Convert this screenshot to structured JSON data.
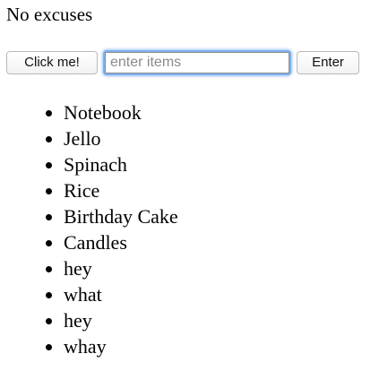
{
  "header": {
    "title": "No excuses"
  },
  "controls": {
    "click_button_label": "Click me!",
    "input_value": "",
    "input_placeholder": "enter items",
    "enter_button_label": "Enter"
  },
  "list": {
    "items": [
      "Notebook",
      "Jello",
      "Spinach",
      "Rice",
      "Birthday Cake",
      "Candles",
      "hey",
      "what",
      "hey",
      "whay"
    ]
  },
  "colors": {
    "focus_ring": "#7fb0f0",
    "text": "#000000",
    "background": "#ffffff"
  }
}
